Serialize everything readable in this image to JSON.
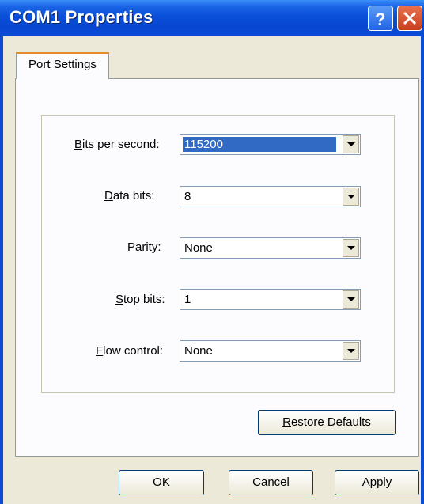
{
  "window": {
    "title": "COM1 Properties"
  },
  "titlebar": {
    "help_icon": "help-icon",
    "close_icon": "close-icon"
  },
  "tabs": [
    {
      "label": "Port Settings",
      "selected": true
    }
  ],
  "form": {
    "bits_per_second": {
      "label_prefix": "",
      "label_accel": "B",
      "label_rest": "its per second:",
      "value": "115200"
    },
    "data_bits": {
      "label_prefix": "",
      "label_accel": "D",
      "label_rest": "ata bits:",
      "value": "8"
    },
    "parity": {
      "label_prefix": "",
      "label_accel": "P",
      "label_rest": "arity:",
      "value": "None"
    },
    "stop_bits": {
      "label_prefix": "",
      "label_accel": "S",
      "label_rest": "top bits:",
      "value": "1"
    },
    "flow_control": {
      "label_prefix": "",
      "label_accel": "F",
      "label_rest": "low control:",
      "value": "None"
    }
  },
  "buttons": {
    "restore_defaults": {
      "accel": "R",
      "rest": "estore Defaults"
    },
    "ok": "OK",
    "cancel": "Cancel",
    "apply": {
      "accel": "A",
      "rest": "pply"
    }
  },
  "colors": {
    "titlebar": "#0a4cd6",
    "selection": "#316ac5",
    "dialog_bg": "#ece9d8"
  }
}
